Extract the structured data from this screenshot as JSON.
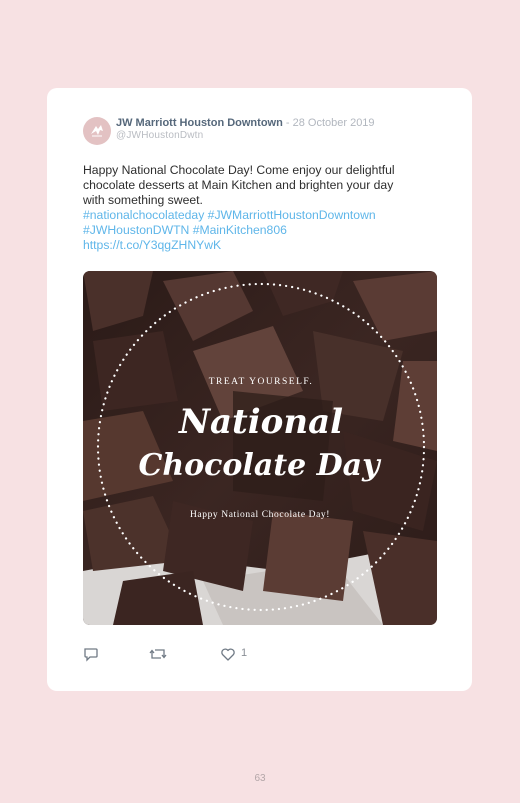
{
  "tweet": {
    "author_name": "JW Marriott Houston Downtown",
    "separator": " - ",
    "date": "28 October 2019",
    "handle": "@JWHoustonDwtn",
    "text_lines": [
      "Happy National Chocolate Day! Come enjoy our delightful",
      "chocolate desserts at Main Kitchen and brighten your day",
      "with something sweet."
    ],
    "hashtags_line1": "#nationalchocolateday #JWMarriottHoustonDowntown",
    "hashtags_line2": "#JWHoustonDWTN #MainKitchen806",
    "url": "https://t.co/Y3qgZHNYwK",
    "image": {
      "kicker": "TREAT YOURSELF.",
      "title_line1": "National",
      "title_line2": "Chocolate Day",
      "caption": "Happy National Chocolate Day!"
    },
    "like_count": "1"
  },
  "page_number": "63",
  "icons": [
    "reply-icon",
    "retweet-icon",
    "heart-icon"
  ],
  "colors": {
    "background": "#f7e1e3",
    "link": "#5fb6e9",
    "chocolate": "#3a2420"
  }
}
